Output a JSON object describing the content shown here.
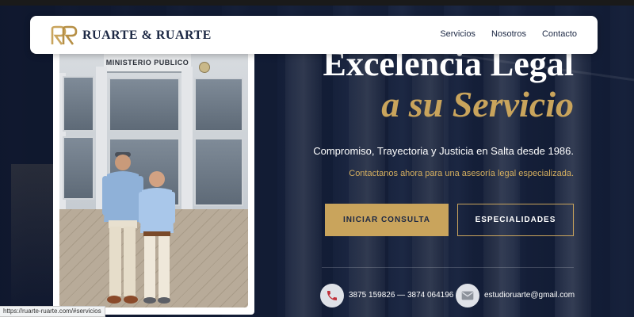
{
  "brand": {
    "name": "RUARTE & RUARTE",
    "logo_icon": "rr-monogram-icon",
    "accent_color": "#c9a45c",
    "navy_color": "#1c2844"
  },
  "nav": {
    "items": [
      {
        "label": "Servicios"
      },
      {
        "label": "Nosotros"
      },
      {
        "label": "Contacto"
      }
    ]
  },
  "photo": {
    "building_sign": "MINISTERIO PUBLICO"
  },
  "hero": {
    "title_line1": "Excelencia Legal",
    "title_line2": "a su Servicio",
    "subtitle": "Compromiso, Trayectoria y Justicia en Salta desde 1986.",
    "cta_text": "Contactanos ahora para una asesoría legal especializada.",
    "primary_button": "INICIAR CONSULTA",
    "secondary_button": "ESPECIALIDADES"
  },
  "contact": {
    "phone": "3875 159826 — 3874 064196",
    "phone_icon": "phone-icon",
    "email": "estudioruarte@gmail.com",
    "email_icon": "mail-icon"
  },
  "status_bar": {
    "url": "https://ruarte-ruarte.com/#servicios"
  }
}
